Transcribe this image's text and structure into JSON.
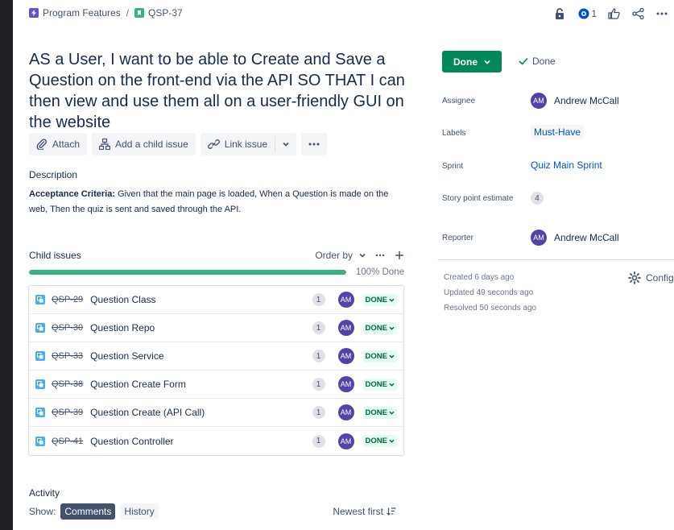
{
  "breadcrumb": {
    "parent_label": "Program Features",
    "issue_key": "QSP-37"
  },
  "header": {
    "watch_count": "1"
  },
  "issue": {
    "title": "AS a User, I want to be able to Create and Save a Question on the front-end via the API SO THAT I can then view and use them all on a user-friendly GUI on the website"
  },
  "actions": {
    "attach": "Attach",
    "add_child": "Add a child issue",
    "link_issue": "Link issue"
  },
  "description": {
    "label": "Description",
    "lead": "Acceptance Criteria:",
    "body": " Given that the main page is loaded, When a Question is made on the web, Then the quiz is sent and saved through the API."
  },
  "child_issues": {
    "label": "Child issues",
    "order_by": "Order by",
    "progress_text": "100% Done",
    "progress_percent": 100,
    "items": [
      {
        "key": "QSP-29",
        "summary": "Question Class",
        "points": "1",
        "assignee": "AM",
        "status": "DONE"
      },
      {
        "key": "QSP-30",
        "summary": "Question Repo",
        "points": "1",
        "assignee": "AM",
        "status": "DONE"
      },
      {
        "key": "QSP-33",
        "summary": "Question Service",
        "points": "1",
        "assignee": "AM",
        "status": "DONE"
      },
      {
        "key": "QSP-38",
        "summary": "Question Create Form",
        "points": "1",
        "assignee": "AM",
        "status": "DONE"
      },
      {
        "key": "QSP-39",
        "summary": "Question Create (API Call)",
        "points": "1",
        "assignee": "AM",
        "status": "DONE"
      },
      {
        "key": "QSP-41",
        "summary": "Question Controller",
        "points": "1",
        "assignee": "AM",
        "status": "DONE"
      }
    ]
  },
  "activity": {
    "label": "Activity",
    "show_label": "Show:",
    "tab_comments": "Comments",
    "tab_history": "History",
    "sort_label": "Newest first"
  },
  "sidebar": {
    "status_button": "Done",
    "resolution": "Done",
    "assignee_label": "Assignee",
    "assignee_initials": "AM",
    "assignee_name": "Andrew McCall",
    "labels_label": "Labels",
    "labels_value": "Must-Have",
    "sprint_label": "Sprint",
    "sprint_value": "Quiz Main Sprint",
    "story_points_label": "Story point estimate",
    "story_points_value": "4",
    "reporter_label": "Reporter",
    "reporter_initials": "AM",
    "reporter_name": "Andrew McCall",
    "created": "Created 6 days ago",
    "updated": "Updated 49 seconds ago",
    "resolved": "Resolved 50 seconds ago",
    "configure": "Configure"
  },
  "colors": {
    "done_green": "#00875A",
    "progress_green": "#36B37E",
    "avatar_purple": "#5243AA",
    "link_blue": "#0052CC",
    "subtask_blue": "#4BADE8"
  }
}
